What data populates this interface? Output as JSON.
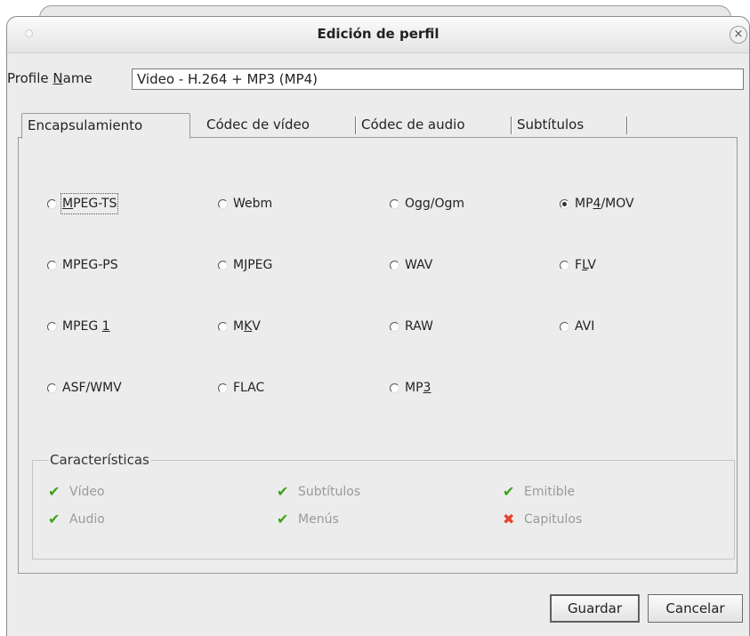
{
  "window": {
    "title": "Edición de perfil",
    "close_glyph": "×"
  },
  "profile": {
    "label_pre": "Profile ",
    "label_mnemonic": "N",
    "label_post": "ame",
    "value": "Video - H.264 + MP3 (MP4)"
  },
  "tabs": [
    {
      "label": "Encapsulamiento",
      "active": true
    },
    {
      "label": "Códec de vídeo",
      "active": false
    },
    {
      "label": "Códec de audio",
      "active": false
    },
    {
      "label": "Subtítulos",
      "active": false
    }
  ],
  "formats": {
    "mpegts": {
      "pre": "",
      "mn": "M",
      "post": "PEG-TS",
      "checked": false
    },
    "webm": {
      "pre": "Webm",
      "mn": "",
      "post": "",
      "checked": false
    },
    "ogg": {
      "pre": "Ogg/Ogm",
      "mn": "",
      "post": "",
      "checked": false
    },
    "mp4": {
      "pre": "MP",
      "mn": "4",
      "post": "/MOV",
      "checked": true
    },
    "mpegps": {
      "pre": "MPEG-PS",
      "mn": "",
      "post": "",
      "checked": false
    },
    "mjpeg": {
      "pre": "M",
      "mn": "J",
      "post": "PEG",
      "checked": false
    },
    "wav": {
      "pre": "WAV",
      "mn": "",
      "post": "",
      "checked": false
    },
    "flv": {
      "pre": "F",
      "mn": "L",
      "post": "V",
      "checked": false
    },
    "mpeg1": {
      "pre": "MPEG ",
      "mn": "1",
      "post": "",
      "checked": false
    },
    "mkv": {
      "pre": "M",
      "mn": "K",
      "post": "V",
      "checked": false
    },
    "raw": {
      "pre": "RAW",
      "mn": "",
      "post": "",
      "checked": false
    },
    "avi": {
      "pre": "AVI",
      "mn": "",
      "post": "",
      "checked": false
    },
    "asf": {
      "pre": "ASF/WMV",
      "mn": "",
      "post": "",
      "checked": false
    },
    "flac": {
      "pre": "FLAC",
      "mn": "",
      "post": "",
      "checked": false
    },
    "mp3": {
      "pre": "MP",
      "mn": "3",
      "post": "",
      "checked": false
    }
  },
  "features": {
    "title": "Características",
    "video": {
      "label": "Vídeo",
      "mark": "✔",
      "supported": true
    },
    "audio": {
      "label": "Audio",
      "mark": "✔",
      "supported": true
    },
    "subtitles": {
      "label": "Subtítulos",
      "mark": "✔",
      "supported": true
    },
    "menus": {
      "label": "Menús",
      "mark": "✔",
      "supported": true
    },
    "streamable": {
      "label": "Emitible",
      "mark": "✔",
      "supported": true
    },
    "chapters": {
      "label": "Capitulos",
      "mark": "✖",
      "supported": false
    }
  },
  "buttons": {
    "save": "Guardar",
    "cancel": "Cancelar"
  },
  "colors": {
    "check_ok": "#3aa418",
    "check_no": "#e8422b",
    "disabled_text": "#9a9a9a",
    "window_bg": "#ececec"
  }
}
